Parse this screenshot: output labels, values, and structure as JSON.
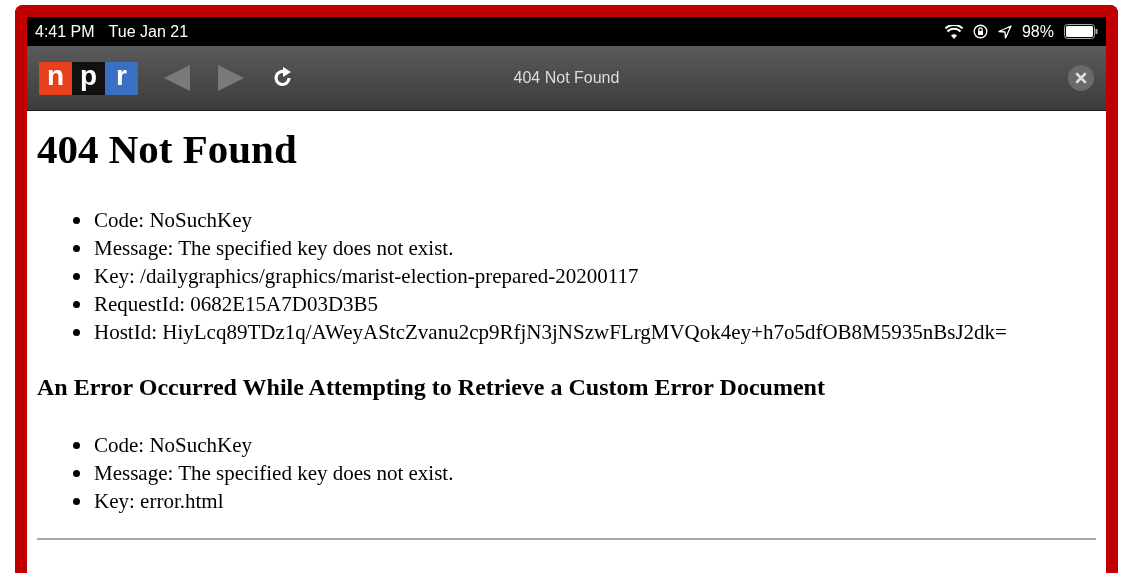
{
  "status_bar": {
    "time": "4:41 PM",
    "date": "Tue Jan 21",
    "battery": "98%"
  },
  "toolbar": {
    "logo": [
      {
        "letter": "n",
        "color": "#e8401c"
      },
      {
        "letter": "p",
        "color": "#111111"
      },
      {
        "letter": "r",
        "color": "#3a6fc4"
      }
    ],
    "back": {
      "disabled": true
    },
    "forward": {
      "disabled": true
    },
    "title": "404 Not Found"
  },
  "page": {
    "heading": "404 Not Found",
    "items": [
      "Code: NoSuchKey",
      "Message: The specified key does not exist.",
      "Key: /dailygraphics/graphics/marist-election-prepared-20200117",
      "RequestId: 0682E15A7D03D3B5",
      "HostId: HiyLcq89TDz1q/AWeyAStcZvanu2cp9RfjN3jNSzwFLrgMVQok4ey+h7o5dfOB8M5935nBsJ2dk="
    ],
    "subheading": "An Error Occurred While Attempting to Retrieve a Custom Error Document",
    "error_items": [
      "Code: NoSuchKey",
      "Message: The specified key does not exist.",
      "Key: error.html"
    ]
  }
}
